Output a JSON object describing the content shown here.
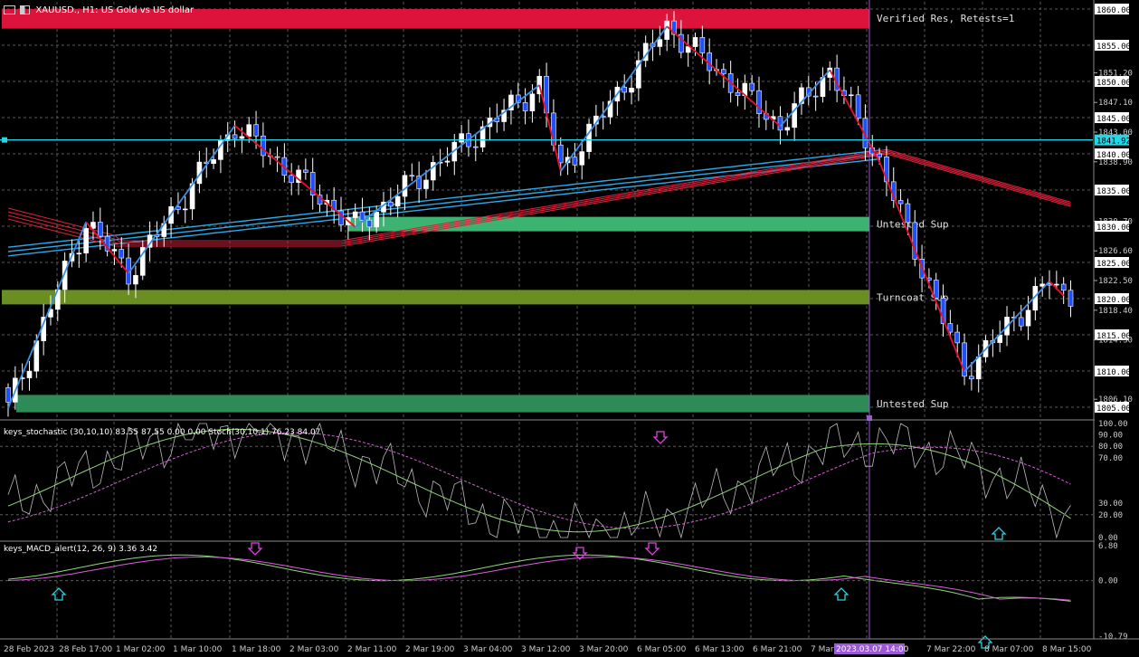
{
  "main": {
    "title": "XAUUSD., H1:  US Gold vs US dollar",
    "zones": [
      {
        "label": "Verified Res, Retests=1",
        "color": "#dc143c",
        "top": 1860.0,
        "bottom": 1857.3
      },
      {
        "label": "Untested Sup",
        "color": "#3cb371",
        "top": 1831.3,
        "bottom": 1829.3
      },
      {
        "label": "Turncoat Sup",
        "color": "#6b8e23",
        "top": 1821.2,
        "bottom": 1819.2
      },
      {
        "label": "Untested Sup",
        "color": "#2e8b57",
        "top": 1806.7,
        "bottom": 1804.3
      }
    ],
    "price_ticks": [
      "1860.00",
      "1855.00",
      "1851.20",
      "1850.00",
      "1847.10",
      "1845.00",
      "1843.00",
      "1841.92",
      "1840.00",
      "1838.90",
      "1835.00",
      "1830.70",
      "1830.00",
      "1826.60",
      "1825.00",
      "1822.50",
      "1820.00",
      "1818.40",
      "1815.00",
      "1814.30",
      "1810.00",
      "1806.10",
      "1805.00"
    ],
    "boxed_ticks": [
      "1860.00",
      "1855.00",
      "1850.00",
      "1845.00",
      "1840.00",
      "1835.00",
      "1830.00",
      "1825.00",
      "1820.00",
      "1815.00",
      "1810.00",
      "1805.00"
    ],
    "current_price": "1841.92",
    "ylim": [
      1803.5,
      1861.0
    ],
    "zigzag": [
      {
        "i": 0,
        "p": 1804.9
      },
      {
        "i": 11,
        "p": 1830.6
      },
      {
        "i": 17,
        "p": 1823.5
      },
      {
        "i": 32,
        "p": 1843.9
      },
      {
        "i": 49,
        "p": 1829.9
      },
      {
        "i": 75,
        "p": 1849.5
      },
      {
        "i": 78,
        "p": 1837.6
      },
      {
        "i": 93,
        "p": 1857.6
      },
      {
        "i": 109,
        "p": 1843.8
      },
      {
        "i": 116,
        "p": 1851.6
      },
      {
        "i": 123,
        "p": 1838.9
      },
      {
        "i": 135,
        "p": 1809.9
      },
      {
        "i": 147,
        "p": 1822.4
      },
      {
        "i": 149,
        "p": 1820.4
      }
    ]
  },
  "stoch": {
    "title": "keys_stochastic (30,10,10) 83.55 87.55 0.00 0.00  Stoch(30,10,1) 76.23 84.07",
    "ticks": [
      "100.00",
      "90.00",
      "80.00",
      "70.00",
      "30.00",
      "20.00",
      "0.00"
    ]
  },
  "macd": {
    "title": "keys_MACD_alert(12, 26, 9) 3.36 3.42",
    "ticks": [
      "6.80",
      "0.00",
      "-10.79"
    ]
  },
  "time_axis": {
    "labels": [
      "28 Feb 2023",
      "28 Feb 17:00",
      "1 Mar 02:00",
      "1 Mar 10:00",
      "1 Mar 18:00",
      "2 Mar 03:00",
      "2 Mar 11:00",
      "2 Mar 19:00",
      "3 Mar 04:00",
      "3 Mar 12:00",
      "3 Mar 20:00",
      "6 Mar 05:00",
      "6 Mar 13:00",
      "6 Mar 21:00",
      "7 Mar 06:00",
      "7 Mar 22:00",
      "8 Mar 07:00",
      "8 Mar 15:00"
    ],
    "highlight": "2023.03.07 14:00"
  },
  "colors": {
    "bull": "#ffffff",
    "bear": "#1e50ff",
    "zig_up": "#3a8ee6",
    "zig_down": "#e8102a"
  }
}
